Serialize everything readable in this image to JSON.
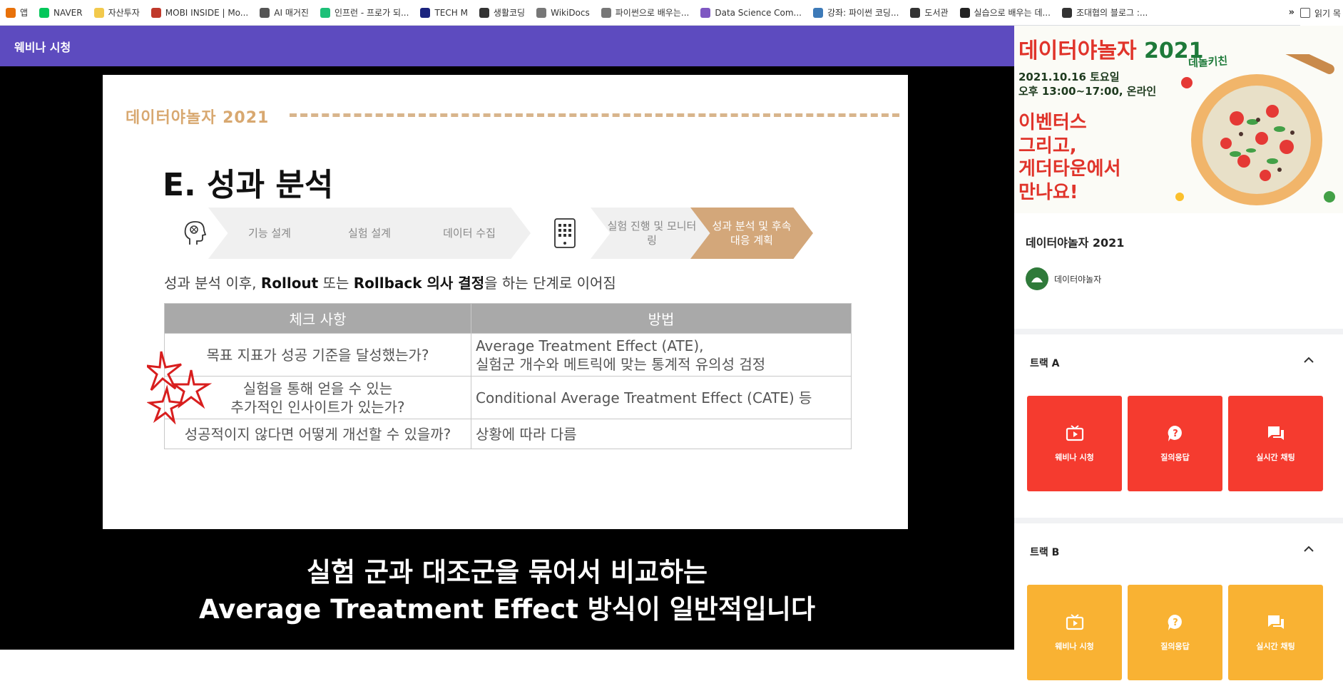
{
  "bookmarks": [
    {
      "label": "앱",
      "icon": "apps-grid-icon",
      "color": "#e8710a"
    },
    {
      "label": "NAVER",
      "icon": "naver-icon",
      "color": "#03c75a"
    },
    {
      "label": "자산투자",
      "icon": "folder-icon",
      "color": "#f2c94c"
    },
    {
      "label": "MOBI INSIDE | Mo...",
      "icon": "mobi-icon",
      "color": "#c0392b"
    },
    {
      "label": "AI 매거진",
      "icon": "pen-icon",
      "color": "#555555"
    },
    {
      "label": "인프런 - 프로가 되...",
      "icon": "inflearn-icon",
      "color": "#1dc078"
    },
    {
      "label": "TECH M",
      "icon": "techm-icon",
      "color": "#1a237e"
    },
    {
      "label": "생활코딩",
      "icon": "globe-icon",
      "color": "#333333"
    },
    {
      "label": "WikiDocs",
      "icon": "wikidocs-icon",
      "color": "#777777"
    },
    {
      "label": "파이썬으로 배우는...",
      "icon": "book-icon",
      "color": "#777777"
    },
    {
      "label": "Data Science Com...",
      "icon": "eye-icon",
      "color": "#7e57c2"
    },
    {
      "label": "강좌: 파이썬 코딩...",
      "icon": "python-icon",
      "color": "#3d7ab8"
    },
    {
      "label": "도서관",
      "icon": "globe-icon",
      "color": "#333333"
    },
    {
      "label": "실습으로 배우는 데...",
      "icon": "bookmark-icon",
      "color": "#222222"
    },
    {
      "label": "조대협의 블로그 :...",
      "icon": "tistory-icon",
      "color": "#333333"
    }
  ],
  "bookmarks_more": "»",
  "reading_list": "읽기 목",
  "topbar": {
    "title": "웨비나 시청"
  },
  "slide": {
    "brand": "데이터야놀자 2021",
    "title": "E. 성과 분석",
    "steps": [
      {
        "label": "기능 설계"
      },
      {
        "label": "실험 설계"
      },
      {
        "label": "데이터 수집"
      },
      {
        "label": "실험 진행 및 모니터링"
      },
      {
        "label": "성과 분석 및 후속 대응 계획"
      }
    ],
    "desc_pre": "성과 분석 이후, ",
    "desc_bold1": "Rollout",
    "desc_mid": " 또는 ",
    "desc_bold2": "Rollback 의사 결정",
    "desc_post": "을 하는 단계로 이어짐",
    "table": {
      "headers": [
        "체크 사항",
        "방법"
      ],
      "rows": [
        {
          "check": "목표 지표가 성공 기준을 달성했는가?",
          "method1": "Average Treatment Effect (ATE),",
          "method2": "실험군 개수와 메트릭에 맞는 통계적 유의성 검정"
        },
        {
          "check1": "실험을 통해 얻을 수 있는",
          "check2": "추가적인 인사이트가 있는가?",
          "method": "Conditional Average Treatment Effect (CATE) 등"
        },
        {
          "check": "성공적이지 않다면 어떻게 개선할 수 있을까?",
          "method": "상황에 따라 다름"
        }
      ]
    }
  },
  "caption": {
    "line1": "실험 군과 대조군을 묶어서 비교하는",
    "line2": "Average Treatment Effect 방식이 일반적입니다"
  },
  "poster": {
    "title_a": "데이터야놀자 ",
    "title_b": "2021",
    "tag": "데놀키친",
    "date": "2021.10.16 토요일",
    "time": "오후 13:00~17:00, 온라인",
    "big1": "이벤터스",
    "big2": "그리고,",
    "big3": "게더타운에서",
    "big4": "만나요!"
  },
  "event": {
    "title": "데이터야놀자 2021",
    "organizer": "데이터야놀자"
  },
  "tracks": [
    {
      "name": "트랙 A",
      "color": "#f53b2f",
      "buttons": [
        "웨비나 시청",
        "질의응답",
        "실시간 채팅"
      ]
    },
    {
      "name": "트랙 B",
      "color": "#f9b233",
      "buttons": [
        "웨비나 시청",
        "질의응답",
        "실시간 채팅"
      ]
    }
  ],
  "colors": {
    "topbar": "#5d4bbf",
    "slide_accent": "#d3a77a",
    "annotation": "#d81e1e"
  }
}
